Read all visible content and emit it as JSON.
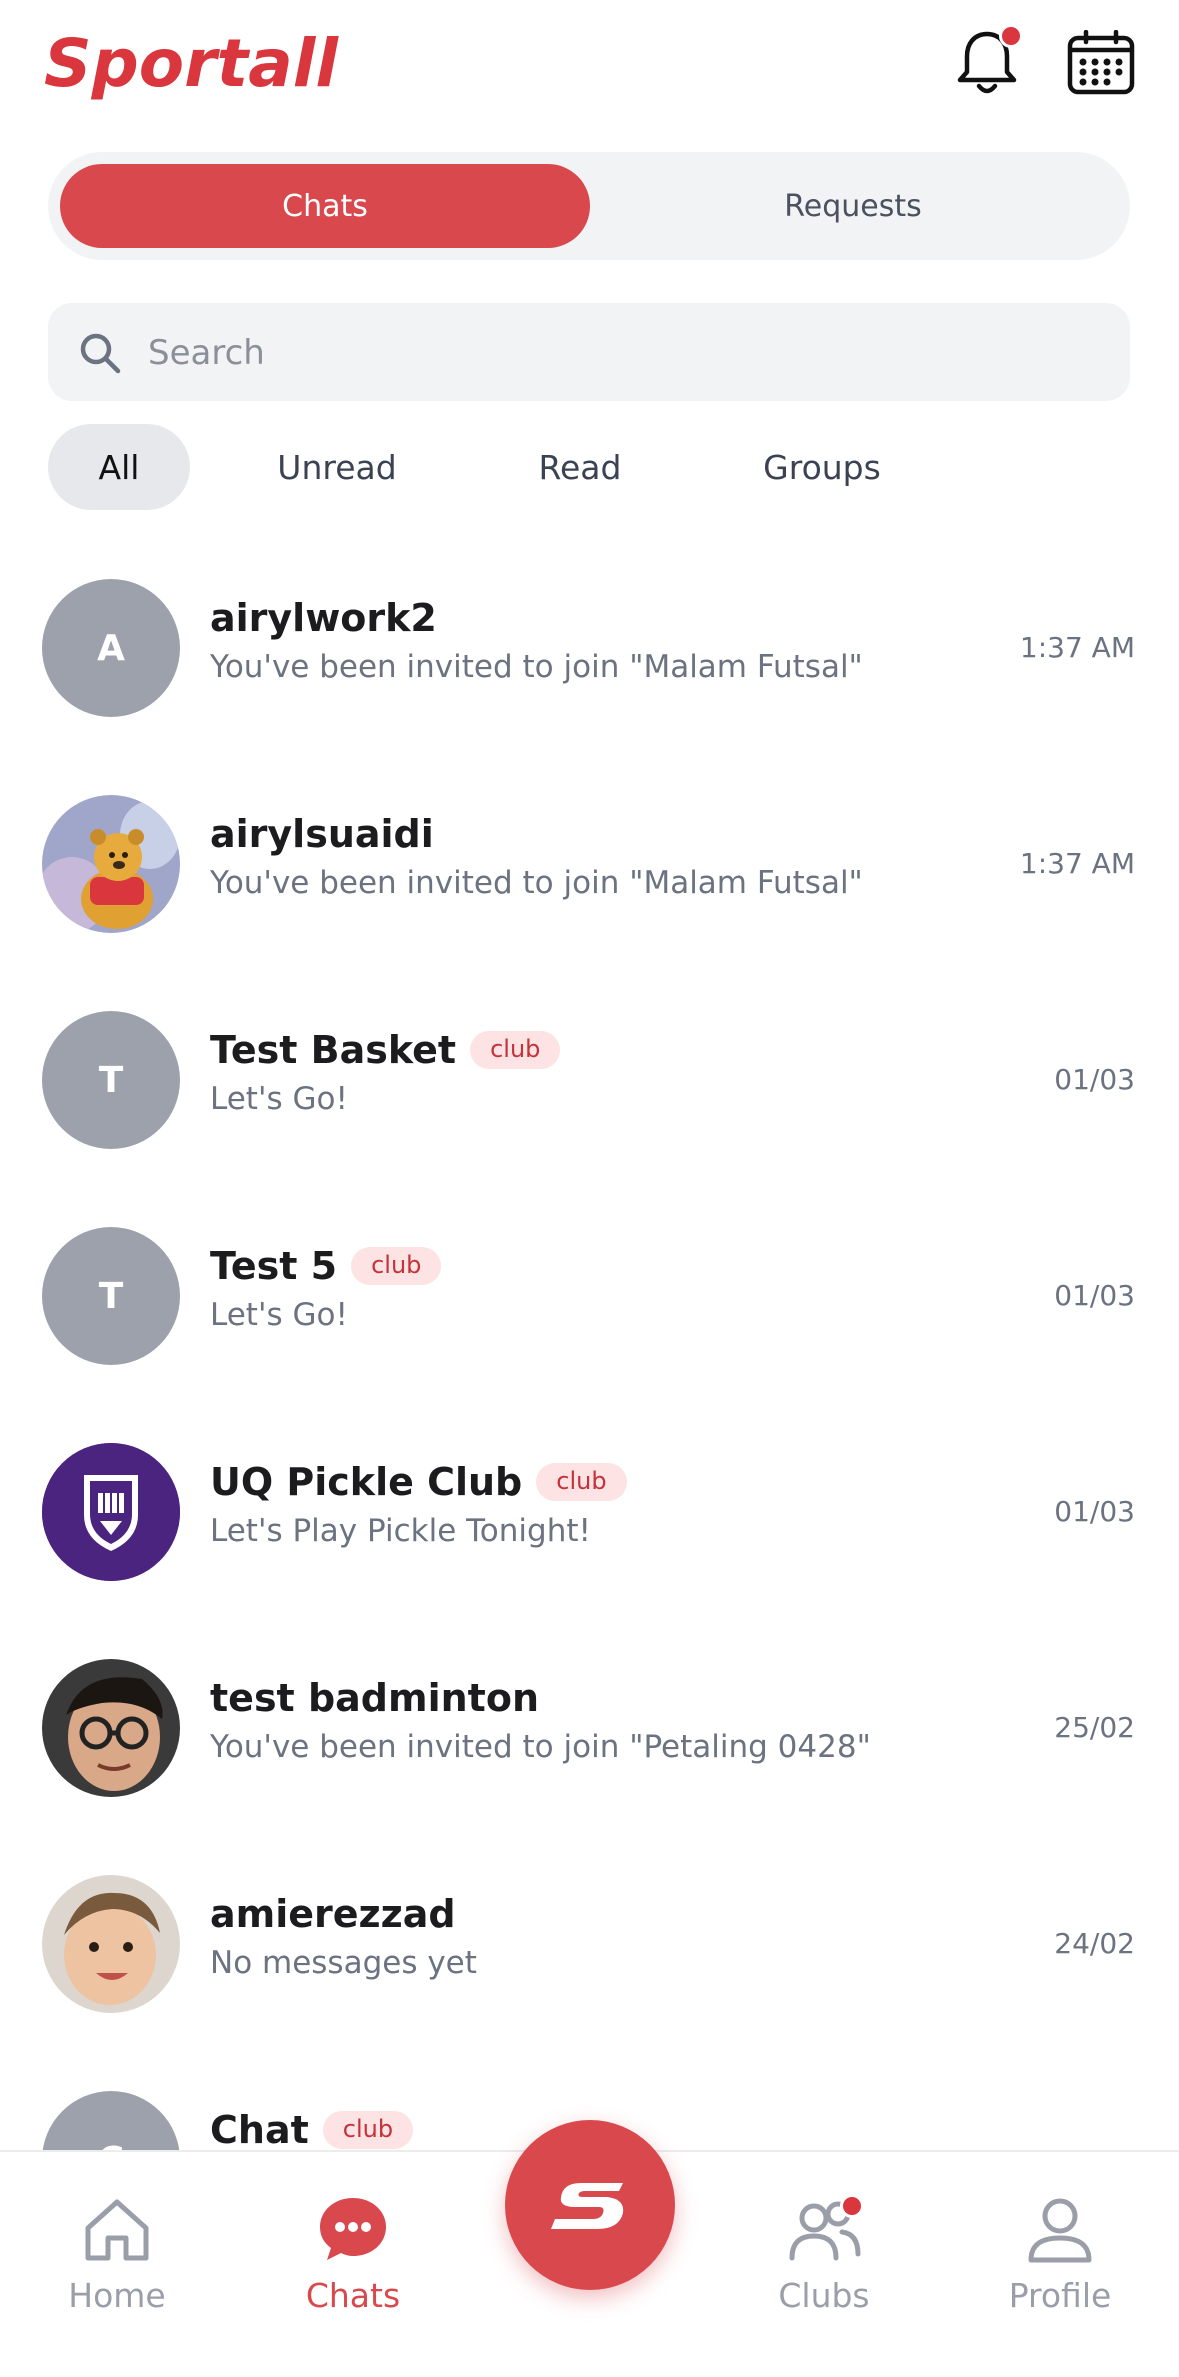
{
  "app": {
    "logo_text": "Sportall",
    "accent": "#d9484d"
  },
  "tabs": {
    "chats": "Chats",
    "requests": "Requests",
    "active": "Chats"
  },
  "search": {
    "placeholder": "Search",
    "value": ""
  },
  "filters": [
    "All",
    "Unread",
    "Read",
    "Groups"
  ],
  "active_filter": "All",
  "chats": [
    {
      "name": "airylwork2",
      "badge": "",
      "preview": "You've been invited to join \"Malam Futsal\"",
      "time": "1:37 AM",
      "avatar": "A",
      "avatar_type": "letter"
    },
    {
      "name": "airylsuaidi",
      "badge": "",
      "preview": "You've been invited to join \"Malam Futsal\"",
      "time": "1:37 AM",
      "avatar": "bear-photo",
      "avatar_type": "photo"
    },
    {
      "name": "Test Basket",
      "badge": "club",
      "preview": "Let's Go!",
      "time": "01/03",
      "avatar": "T",
      "avatar_type": "letter"
    },
    {
      "name": "Test 5",
      "badge": "club",
      "preview": "Let's Go!",
      "time": "01/03",
      "avatar": "T",
      "avatar_type": "letter"
    },
    {
      "name": "UQ Pickle Club",
      "badge": "club",
      "preview": "Let's Play Pickle Tonight!",
      "time": "01/03",
      "avatar": "shield-crest",
      "avatar_type": "crest"
    },
    {
      "name": "test badminton",
      "badge": "",
      "preview": "You've been invited to join \"Petaling 0428\"",
      "time": "25/02",
      "avatar": "man-glasses-photo",
      "avatar_type": "photo"
    },
    {
      "name": "amierezzad",
      "badge": "",
      "preview": "No messages yet",
      "time": "24/02",
      "avatar": "child-photo",
      "avatar_type": "photo"
    },
    {
      "name": "Chat",
      "badge": "club",
      "preview": "",
      "time": "",
      "avatar": "C",
      "avatar_type": "letter"
    }
  ],
  "nav": {
    "home": "Home",
    "chats": "Chats",
    "clubs": "Clubs",
    "profile": "Profile",
    "active": "Chats"
  }
}
